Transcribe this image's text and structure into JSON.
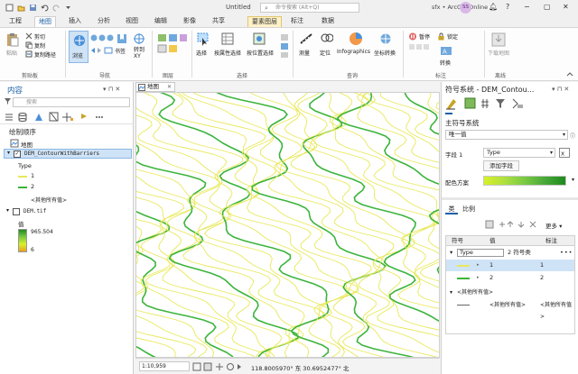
{
  "titlebar": {
    "document": "Untitled",
    "search_placeholder": "命令搜索 (Alt+Q)",
    "app_name": "sfx • ArcGIS Online",
    "avatar_initials": "SS"
  },
  "ribbon_tabs": [
    "工程",
    "地图",
    "插入",
    "分析",
    "视图",
    "编辑",
    "影像",
    "共享",
    "要素图层",
    "标注",
    "数据"
  ],
  "ribbon": {
    "groups": [
      "剪贴板",
      "导航",
      "图层",
      "选择",
      "查询",
      "标注",
      "离线"
    ],
    "clipboard": {
      "paste": "粘贴",
      "cut": "剪切",
      "copy": "复制",
      "copy_path": "复制路径"
    },
    "navigate": {
      "explore": "浏览",
      "bookmarks": "书签",
      "goto": "转到\nXY"
    },
    "selection": {
      "select": "选择",
      "by_attributes": "按属性选择",
      "by_location": "按位置选择"
    },
    "inquiry": {
      "measure": "测量",
      "locate": "定位",
      "infographics": "Infographics",
      "coordinate_conversion": "坐标转换"
    },
    "labeling": {
      "pause": "暂停",
      "lock": "锁定",
      "convert": "转换"
    },
    "offline": {
      "download_map": "下载地图"
    }
  },
  "contents": {
    "title": "内容",
    "search_placeholder": "搜索",
    "drawing_order": "绘制顺序",
    "map_item": "地图",
    "layer1": "DEM_ContourWithBarriers",
    "layer1_field": "Type",
    "layer1_values": [
      "1",
      "2",
      "<其他所有值>"
    ],
    "layer2": "DEM.tif",
    "layer2_legend_title": "值",
    "layer2_high": "965.504",
    "layer2_low": "6"
  },
  "map": {
    "tab": "地图",
    "scale": "1:10,959",
    "coordinates": "118.8005970° 东  30.6952477° 北"
  },
  "symbology": {
    "title": "符号系统 - DEM_Contou...",
    "primary": "主符号系统",
    "method": "唯一值",
    "field_label": "字段 1",
    "field_value": "Type",
    "add_field": "添加字段",
    "color_scheme": "配色方案",
    "tabs": [
      "类",
      "比例"
    ],
    "more": "更多",
    "headers": [
      "符号",
      "值",
      "标注"
    ],
    "group_row": {
      "value": "Type",
      "count": "2 符号类"
    },
    "rows": [
      {
        "value": "1",
        "label": "1"
      },
      {
        "value": "2",
        "label": "2"
      }
    ],
    "other_header": "<其他所有值>",
    "other_row": {
      "value": "<其他所有值>",
      "label": "<其他所有值>"
    }
  },
  "colors": {
    "accent": "#1b5fa8",
    "contour_yellow": "#e8e85a",
    "contour_green": "#3cb43c",
    "ramp_high": "#1e8a1e",
    "ramp_low": "#d8f028"
  }
}
